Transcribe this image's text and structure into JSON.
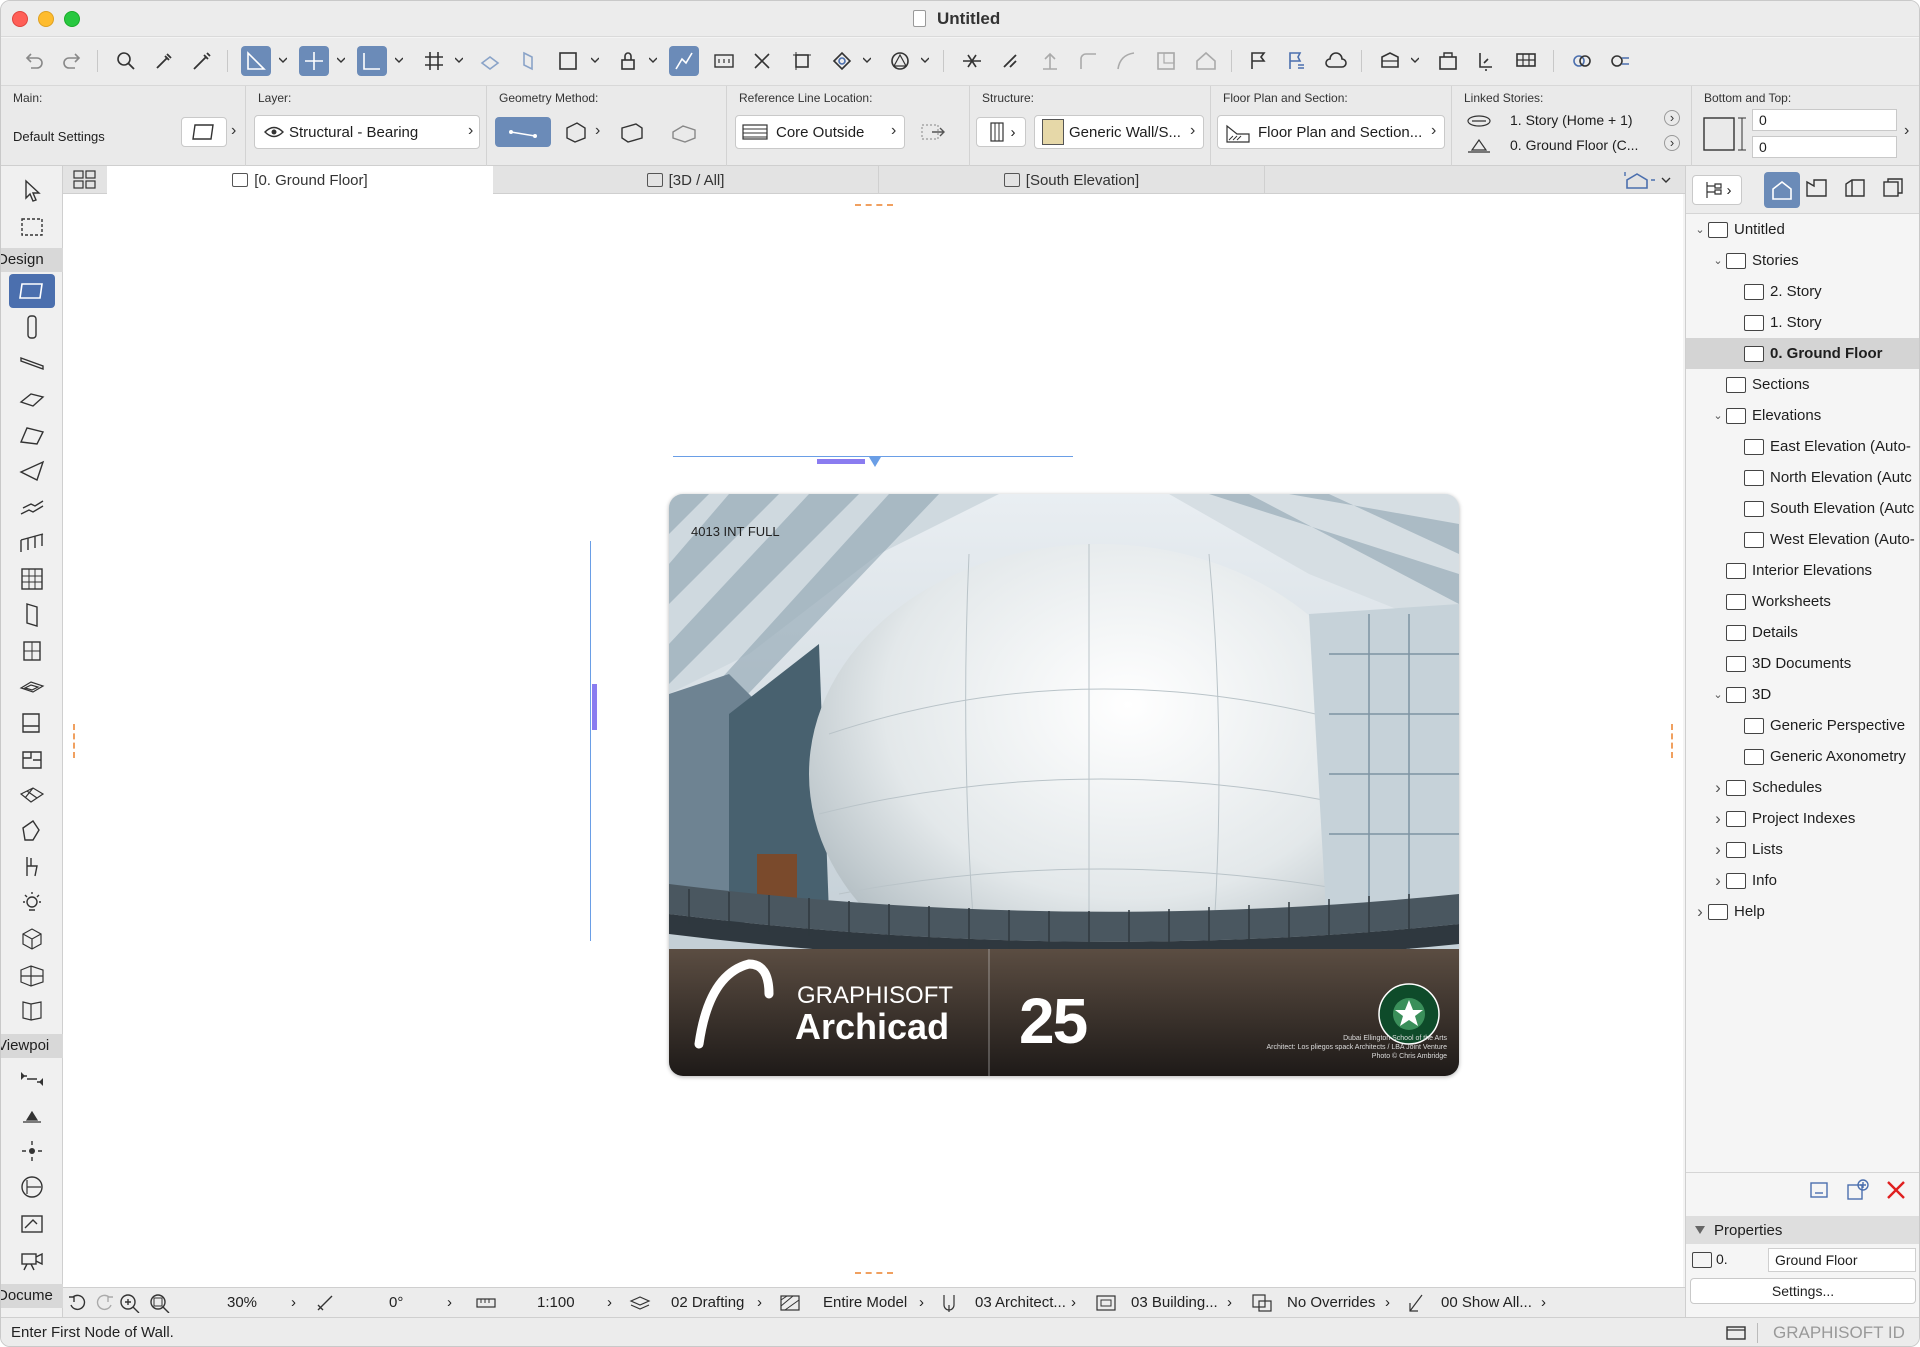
{
  "window": {
    "title": "Untitled"
  },
  "infobox": {
    "main": {
      "label": "Main:",
      "value": "Default Settings"
    },
    "layer": {
      "label": "Layer:",
      "value": "Structural - Bearing"
    },
    "geometry": {
      "label": "Geometry Method:"
    },
    "refline": {
      "label": "Reference Line Location:",
      "value": "Core Outside"
    },
    "structure": {
      "label": "Structure:",
      "value": "Generic Wall/S..."
    },
    "floorplan": {
      "label": "Floor Plan and Section:",
      "value": "Floor Plan and Section..."
    },
    "linked": {
      "label": "Linked Stories:",
      "top": "1. Story (Home + 1)",
      "bottom": "0. Ground Floor (C..."
    },
    "bottomtop": {
      "label": "Bottom and Top:",
      "top_value": "0",
      "bottom_value": "0"
    }
  },
  "toolbox": {
    "groups": [
      "Design",
      "Viewpoi",
      "Docume"
    ]
  },
  "tabs": [
    {
      "label": "[0. Ground Floor]"
    },
    {
      "label": "[3D / All]"
    },
    {
      "label": "[South Elevation]"
    }
  ],
  "splash": {
    "corner_text": "4013 INT FULL",
    "brand": "GRAPHISOFT",
    "product": "Archicad",
    "version": "25",
    "credit_lines": [
      "Dubai Ellington School of the Arts",
      "Architect: Los pliegos spack Architects / LBA Joint Venture",
      "Photo © Chris Ambridge"
    ]
  },
  "navigator": {
    "items": [
      {
        "label": "Untitled",
        "indent": 0,
        "arrow": "down"
      },
      {
        "label": "Stories",
        "indent": 1,
        "arrow": "down"
      },
      {
        "label": "2. Story",
        "indent": 2,
        "arrow": ""
      },
      {
        "label": "1. Story",
        "indent": 2,
        "arrow": ""
      },
      {
        "label": "0. Ground Floor",
        "indent": 2,
        "arrow": "",
        "selected": true
      },
      {
        "label": "Sections",
        "indent": 1,
        "arrow": ""
      },
      {
        "label": "Elevations",
        "indent": 1,
        "arrow": "down"
      },
      {
        "label": "East Elevation (Auto-",
        "indent": 2,
        "arrow": ""
      },
      {
        "label": "North Elevation (Autc",
        "indent": 2,
        "arrow": ""
      },
      {
        "label": "South Elevation (Autc",
        "indent": 2,
        "arrow": ""
      },
      {
        "label": "West Elevation (Auto-",
        "indent": 2,
        "arrow": ""
      },
      {
        "label": "Interior Elevations",
        "indent": 1,
        "arrow": ""
      },
      {
        "label": "Worksheets",
        "indent": 1,
        "arrow": ""
      },
      {
        "label": "Details",
        "indent": 1,
        "arrow": ""
      },
      {
        "label": "3D Documents",
        "indent": 1,
        "arrow": ""
      },
      {
        "label": "3D",
        "indent": 1,
        "arrow": "down"
      },
      {
        "label": "Generic Perspective",
        "indent": 2,
        "arrow": ""
      },
      {
        "label": "Generic Axonometry",
        "indent": 2,
        "arrow": ""
      },
      {
        "label": "Schedules",
        "indent": 1,
        "arrow": "right"
      },
      {
        "label": "Project Indexes",
        "indent": 1,
        "arrow": "right"
      },
      {
        "label": "Lists",
        "indent": 1,
        "arrow": "right"
      },
      {
        "label": "Info",
        "indent": 1,
        "arrow": "right"
      },
      {
        "label": "Help",
        "indent": 0,
        "arrow": "right"
      }
    ]
  },
  "properties": {
    "header": "Properties",
    "id": "0.",
    "name": "Ground Floor",
    "settings_button": "Settings...",
    "brand": "GRAPHISOFT ID"
  },
  "statusbar": {
    "zoom": "30%",
    "angle": "0°",
    "scale": "1:100",
    "layer_combo": "02 Drafting",
    "model_view": "Entire Model",
    "pen_set": "03 Architect...",
    "mvo": "03 Building...",
    "overrides": "No Overrides",
    "renovation": "00 Show All..."
  },
  "hint": "Enter First Node of Wall.",
  "colors": {
    "accent": "#4b6fae",
    "selected_tool": "#4b6fae",
    "close_red": "#ff5f57"
  }
}
